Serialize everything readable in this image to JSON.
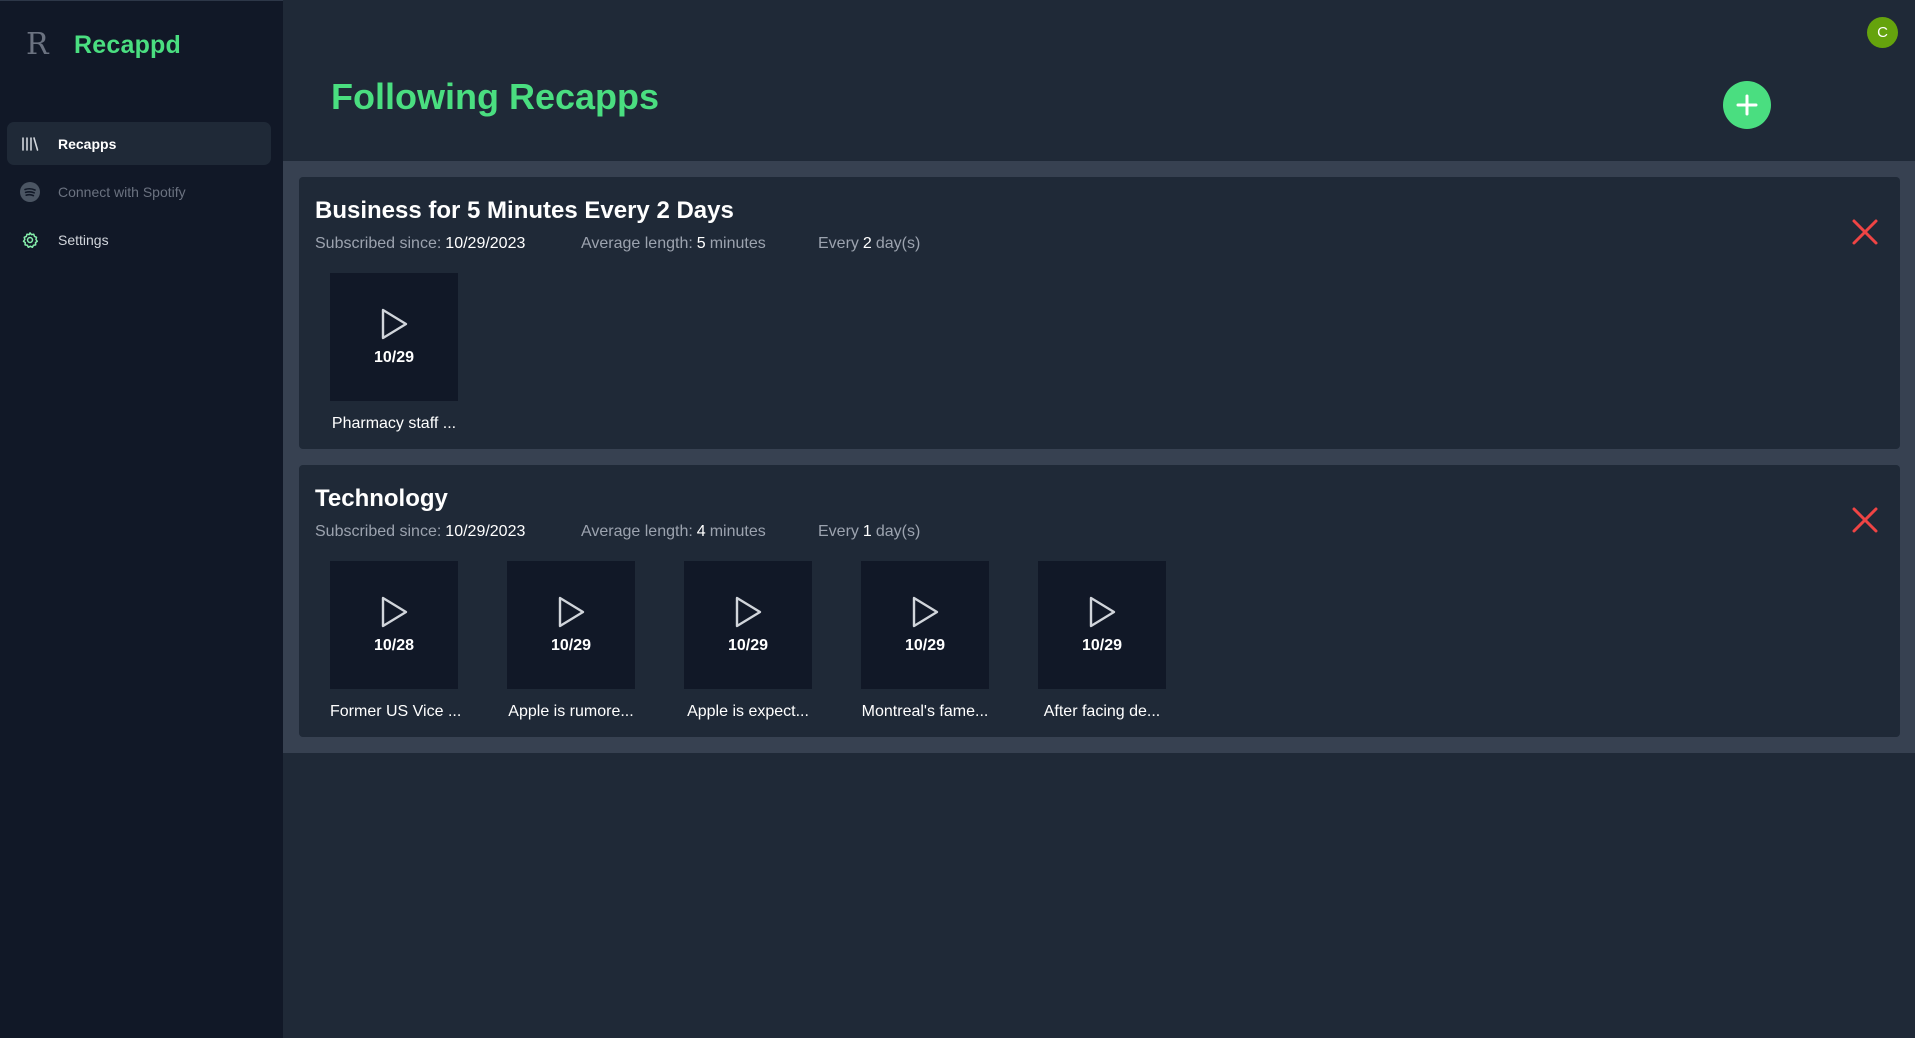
{
  "brand": {
    "logo": "R",
    "name": "Recappd"
  },
  "sidebar": {
    "items": [
      {
        "label": "Recapps",
        "icon": "library-icon",
        "state": "active"
      },
      {
        "label": "Connect with Spotify",
        "icon": "spotify-icon",
        "state": "disabled"
      },
      {
        "label": "Settings",
        "icon": "gear-icon",
        "state": "normal"
      }
    ]
  },
  "header": {
    "title": "Following Recapps",
    "avatar_initial": "C"
  },
  "colors": {
    "accent": "#4ade80",
    "danger": "#ef4444",
    "avatar": "#65a30d"
  },
  "cards": [
    {
      "title": "Business for 5 Minutes Every 2 Days",
      "subscribed_label": "Subscribed since:",
      "subscribed_value": "10/29/2023",
      "avg_label": "Average length:",
      "avg_value": "5",
      "avg_unit": "minutes",
      "every_label": "Every",
      "every_value": "2",
      "every_unit": "day(s)",
      "episodes": [
        {
          "date": "10/29",
          "title": "Pharmacy staff ..."
        }
      ]
    },
    {
      "title": "Technology",
      "subscribed_label": "Subscribed since:",
      "subscribed_value": "10/29/2023",
      "avg_label": "Average length:",
      "avg_value": "4",
      "avg_unit": "minutes",
      "every_label": "Every",
      "every_value": "1",
      "every_unit": "day(s)",
      "episodes": [
        {
          "date": "10/28",
          "title": "Former US Vice ..."
        },
        {
          "date": "10/29",
          "title": "Apple is rumore..."
        },
        {
          "date": "10/29",
          "title": "Apple is expect..."
        },
        {
          "date": "10/29",
          "title": "Montreal's fame..."
        },
        {
          "date": "10/29",
          "title": "After facing de..."
        }
      ]
    }
  ]
}
